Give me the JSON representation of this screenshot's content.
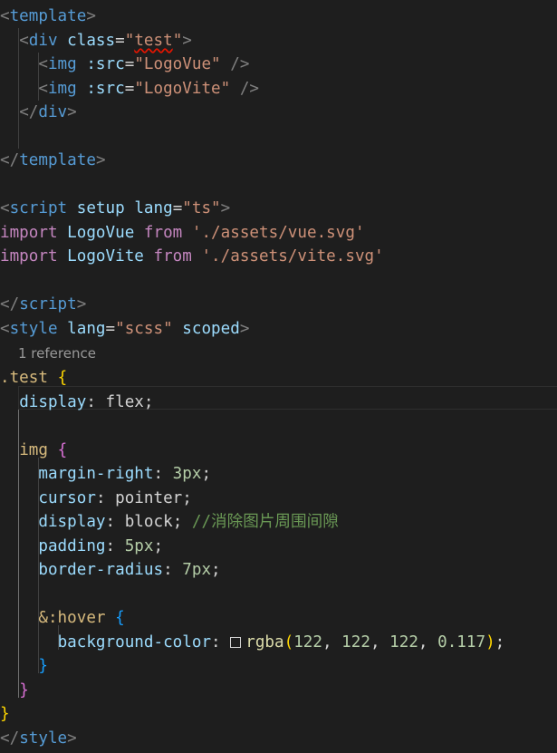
{
  "editor": {
    "codelens_text": "1 reference",
    "lines": [
      [
        [
          "<",
          "br"
        ],
        [
          "template",
          "tag"
        ],
        [
          ">",
          "br"
        ]
      ],
      [
        [
          "  ",
          "id"
        ],
        [
          "<",
          "br"
        ],
        [
          "div",
          "tag"
        ],
        [
          " ",
          "id"
        ],
        [
          "class",
          "attr"
        ],
        [
          "=",
          "eq"
        ],
        [
          "\"",
          "str"
        ],
        [
          "test",
          "str-err"
        ],
        [
          "\"",
          "str"
        ],
        [
          ">",
          "br"
        ]
      ],
      [
        [
          "    ",
          "id"
        ],
        [
          "<",
          "br"
        ],
        [
          "img",
          "tag"
        ],
        [
          " ",
          "id"
        ],
        [
          ":src",
          "attr"
        ],
        [
          "=",
          "eq"
        ],
        [
          "\"LogoVue\"",
          "str"
        ],
        [
          " ",
          "id"
        ],
        [
          "/>",
          "br"
        ]
      ],
      [
        [
          "    ",
          "id"
        ],
        [
          "<",
          "br"
        ],
        [
          "img",
          "tag"
        ],
        [
          " ",
          "id"
        ],
        [
          ":src",
          "attr"
        ],
        [
          "=",
          "eq"
        ],
        [
          "\"LogoVite\"",
          "str"
        ],
        [
          " ",
          "id"
        ],
        [
          "/>",
          "br"
        ]
      ],
      [
        [
          "  ",
          "id"
        ],
        [
          "</",
          "br"
        ],
        [
          "div",
          "tag"
        ],
        [
          ">",
          "br"
        ]
      ],
      [],
      [
        [
          "</",
          "br"
        ],
        [
          "template",
          "tag"
        ],
        [
          ">",
          "br"
        ]
      ],
      [],
      [
        [
          "<",
          "br"
        ],
        [
          "script",
          "tag"
        ],
        [
          " ",
          "id"
        ],
        [
          "setup",
          "attr"
        ],
        [
          " ",
          "id"
        ],
        [
          "lang",
          "attr"
        ],
        [
          "=",
          "eq"
        ],
        [
          "\"ts\"",
          "str"
        ],
        [
          ">",
          "br"
        ]
      ],
      [
        [
          "import",
          "kw"
        ],
        [
          " LogoVue ",
          "attr"
        ],
        [
          "from",
          "kw"
        ],
        [
          " ",
          "id"
        ],
        [
          "'./assets/vue.svg'",
          "str"
        ]
      ],
      [
        [
          "import",
          "kw"
        ],
        [
          " LogoVite ",
          "attr"
        ],
        [
          "from",
          "kw"
        ],
        [
          " ",
          "id"
        ],
        [
          "'./assets/vite.svg'",
          "str"
        ]
      ],
      [],
      [
        [
          "</",
          "br"
        ],
        [
          "script",
          "tag"
        ],
        [
          ">",
          "br"
        ]
      ],
      [
        [
          "<",
          "br"
        ],
        [
          "style",
          "tag"
        ],
        [
          " ",
          "id"
        ],
        [
          "lang",
          "attr"
        ],
        [
          "=",
          "eq"
        ],
        [
          "\"scss\"",
          "str"
        ],
        [
          " ",
          "id"
        ],
        [
          "scoped",
          "attr"
        ],
        [
          ">",
          "br"
        ]
      ],
      null,
      [
        [
          ".test",
          "sel"
        ],
        [
          " ",
          "id"
        ],
        [
          "{",
          "b1"
        ]
      ],
      [
        [
          "  ",
          "id"
        ],
        [
          "display",
          "prop"
        ],
        [
          ": ",
          "id"
        ],
        [
          "flex",
          "id"
        ],
        [
          ";",
          "id"
        ]
      ],
      [],
      [
        [
          "  ",
          "id"
        ],
        [
          "img",
          "sel"
        ],
        [
          " ",
          "id"
        ],
        [
          "{",
          "b2"
        ]
      ],
      [
        [
          "    ",
          "id"
        ],
        [
          "margin-right",
          "prop"
        ],
        [
          ": ",
          "id"
        ],
        [
          "3px",
          "num"
        ],
        [
          ";",
          "id"
        ]
      ],
      [
        [
          "    ",
          "id"
        ],
        [
          "cursor",
          "prop"
        ],
        [
          ": ",
          "id"
        ],
        [
          "pointer",
          "id"
        ],
        [
          ";",
          "id"
        ]
      ],
      [
        [
          "    ",
          "id"
        ],
        [
          "display",
          "prop"
        ],
        [
          ": ",
          "id"
        ],
        [
          "block",
          "id"
        ],
        [
          "; ",
          "id"
        ],
        [
          "//消除图片周围间隙",
          "cmt"
        ]
      ],
      [
        [
          "    ",
          "id"
        ],
        [
          "padding",
          "prop"
        ],
        [
          ": ",
          "id"
        ],
        [
          "5px",
          "num"
        ],
        [
          ";",
          "id"
        ]
      ],
      [
        [
          "    ",
          "id"
        ],
        [
          "border-radius",
          "prop"
        ],
        [
          ": ",
          "id"
        ],
        [
          "7px",
          "num"
        ],
        [
          ";",
          "id"
        ]
      ],
      [],
      [
        [
          "    ",
          "id"
        ],
        [
          "&:hover",
          "sel"
        ],
        [
          " ",
          "id"
        ],
        [
          "{",
          "b3"
        ]
      ],
      [
        [
          "      ",
          "id"
        ],
        [
          "background-color",
          "prop"
        ],
        [
          ": ",
          "id"
        ],
        [
          "",
          "swatch"
        ],
        [
          "rgba",
          "fn"
        ],
        [
          "(",
          "b1"
        ],
        [
          "122",
          "num"
        ],
        [
          ", ",
          "id"
        ],
        [
          "122",
          "num"
        ],
        [
          ", ",
          "id"
        ],
        [
          "122",
          "num"
        ],
        [
          ", ",
          "id"
        ],
        [
          "0.117",
          "num"
        ],
        [
          ")",
          "b1"
        ],
        [
          ";",
          "id"
        ]
      ],
      [
        [
          "    ",
          "id"
        ],
        [
          "}",
          "b3"
        ]
      ],
      [
        [
          "  ",
          "id"
        ],
        [
          "}",
          "b2"
        ]
      ],
      [
        [
          "}",
          "b1"
        ]
      ],
      [
        [
          "</",
          "br"
        ],
        [
          "style",
          "tag"
        ],
        [
          ">",
          "br"
        ]
      ]
    ]
  },
  "colors": {
    "background": "#1e1e1e",
    "tag": "#569cd6",
    "string": "#ce9178",
    "attribute": "#9cdcfe",
    "keyword": "#c586c0",
    "selector": "#d7ba7d",
    "number": "#b5cea8",
    "function": "#dcdcaa",
    "comment": "#6a9955",
    "bracket_level_1": "#ffd700",
    "bracket_level_2": "#da70d6",
    "bracket_level_3": "#179fff",
    "error_squiggle": "#e51400"
  }
}
